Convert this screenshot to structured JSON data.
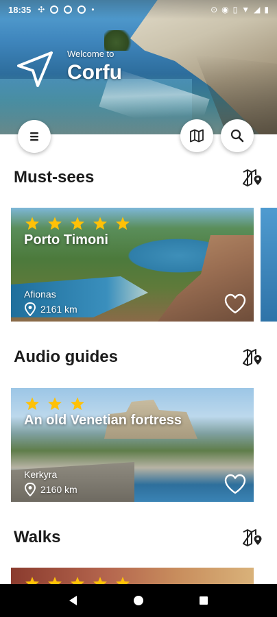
{
  "status_bar": {
    "time": "18:35",
    "left_icons": [
      "fan-icon",
      "app-icon",
      "app-icon",
      "app-icon",
      "dot-icon"
    ],
    "right_icons": [
      "location-icon",
      "hotspot-icon",
      "vibrate-icon",
      "wifi-icon",
      "signal-icon",
      "battery-icon"
    ]
  },
  "hero": {
    "welcome": "Welcome to",
    "city": "Corfu"
  },
  "toolbar": {
    "menu_icon": "menu-icon",
    "map_icon": "map-icon",
    "search_icon": "search-icon"
  },
  "sections": [
    {
      "title": "Must-sees",
      "card": {
        "stars": 5,
        "title": "Porto Timoni",
        "place": "Afionas",
        "distance": "2161 km",
        "favorite": false
      }
    },
    {
      "title": "Audio guides",
      "card": {
        "stars": 3,
        "title": "An old Venetian fortress",
        "place": "Kerkyra",
        "distance": "2160 km",
        "favorite": false
      }
    },
    {
      "title": "Walks",
      "card": {
        "stars": 5
      }
    }
  ],
  "colors": {
    "star": "#FFC107",
    "text": "#1C1C1C",
    "nav_bar": "#000000"
  },
  "nav": {
    "back_icon": "back-icon",
    "home_icon": "home-icon",
    "recents_icon": "recents-icon"
  }
}
